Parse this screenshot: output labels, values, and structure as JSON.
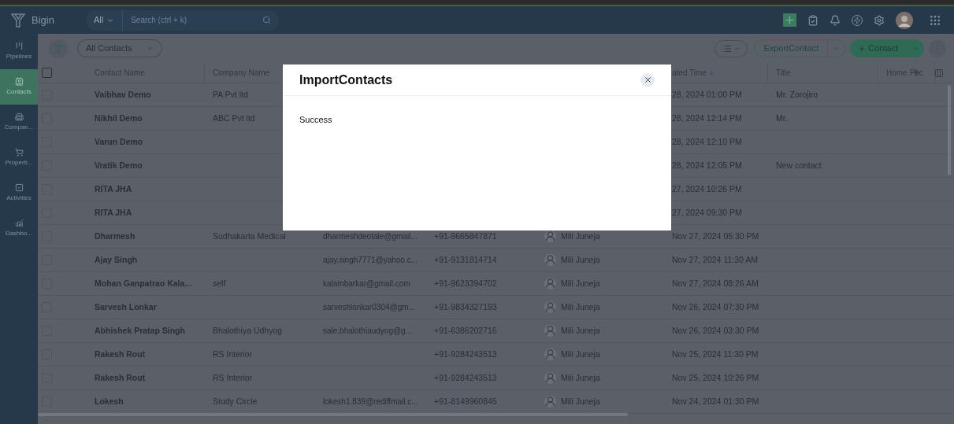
{
  "app": {
    "name": "Bigin",
    "search": {
      "scope": "All",
      "placeholder": "Search (ctrl + k)"
    }
  },
  "sidebar": {
    "items": [
      {
        "label": "Pipelines",
        "selected": false
      },
      {
        "label": "Contacts",
        "selected": true
      },
      {
        "label": "Compan...",
        "selected": false
      },
      {
        "label": "Properti...",
        "selected": false
      },
      {
        "label": "Activities",
        "selected": false
      },
      {
        "label": "Dashbo...",
        "selected": false
      }
    ]
  },
  "toolbar": {
    "view": "All Contacts",
    "export_button": "ExportContact",
    "add_button": "Contact"
  },
  "table": {
    "select_all_checked": false,
    "headers": {
      "contact_name": "Contact Name",
      "company_name": "Company Name",
      "created_time": {
        "label": "ated Time",
        "sorted_descending": true
      },
      "title": "Title",
      "column_9": "Home Phc"
    },
    "rows": [
      {
        "checked": false,
        "name": "Vaibhav Demo",
        "company": "PA Pvt ltd",
        "created": "28, 2024 01:00 PM",
        "title": "Mr. Zorojiro"
      },
      {
        "checked": false,
        "name": "Nikhil Demo",
        "company": "ABC Pvt ltd",
        "created": "28, 2024 12:14 PM",
        "title": "Mr."
      },
      {
        "checked": false,
        "name": "Varun Demo",
        "created": "28, 2024 12:10 PM"
      },
      {
        "checked": false,
        "name": "Vratik Demo",
        "created": "28, 2024 12:05 PM",
        "title": "New contact"
      },
      {
        "checked": false,
        "name": "RITA JHA",
        "created": "27, 2024 10:26 PM"
      },
      {
        "checked": false,
        "name": "RITA JHA",
        "created": "27, 2024 09:30 PM"
      },
      {
        "checked": false,
        "name": "Dharmesh",
        "company": "Sudhakarta Medical",
        "email": "dharmeshdeotale@gmail...",
        "phone": "+91-9665847871",
        "owner": "Mili Juneja",
        "created": "Nov 27, 2024 05:30 PM"
      },
      {
        "checked": false,
        "name": "Ajay Singh",
        "email": "ajay.singh7771@yahoo.c...",
        "phone": "+91-9131814714",
        "owner": "Mili Juneja",
        "created": "Nov 27, 2024 11:30 AM"
      },
      {
        "checked": false,
        "name": "Mohan Ganpatrao Kala...",
        "company": "self",
        "email": "kalambarkar@gmail.com",
        "phone": "+91-9623394702",
        "owner": "Mili Juneja",
        "created": "Nov 27, 2024 08:26 AM"
      },
      {
        "checked": false,
        "name": "Sarvesh Lonkar",
        "email": "sarveshlonkar0304@gm...",
        "phone": "+91-9834327193",
        "owner": "Mili Juneja",
        "created": "Nov 26, 2024 07:30 PM"
      },
      {
        "checked": false,
        "name": "Abhishek Pratap Singh",
        "company": "Bhalothiya Udhyog",
        "email": "sale.bhalothiaudyog@g...",
        "phone": "+91-6386202716",
        "owner": "Mili Juneja",
        "created": "Nov 26, 2024 03:30 PM"
      },
      {
        "checked": false,
        "name": "Rakesh Rout",
        "company": "RS Interior",
        "phone": "+91-9284243513",
        "owner": "Mili Juneja",
        "created": "Nov 25, 2024 11:30 PM"
      },
      {
        "checked": false,
        "name": "Rakesh Rout",
        "company": "RS Interior",
        "phone": "+91-9284243513",
        "owner": "Mili Juneja",
        "created": "Nov 25, 2024 10:26 PM"
      },
      {
        "checked": false,
        "name": "Lokesh",
        "company": "Study Circle",
        "email": "lokesh1.839@rediffmail.c...",
        "phone": "+91-8149960845",
        "owner": "Mili Juneja",
        "created": "Nov 24, 2024 01:30 PM"
      }
    ]
  },
  "dialog": {
    "title": "ImportContacts",
    "message": "Success"
  }
}
